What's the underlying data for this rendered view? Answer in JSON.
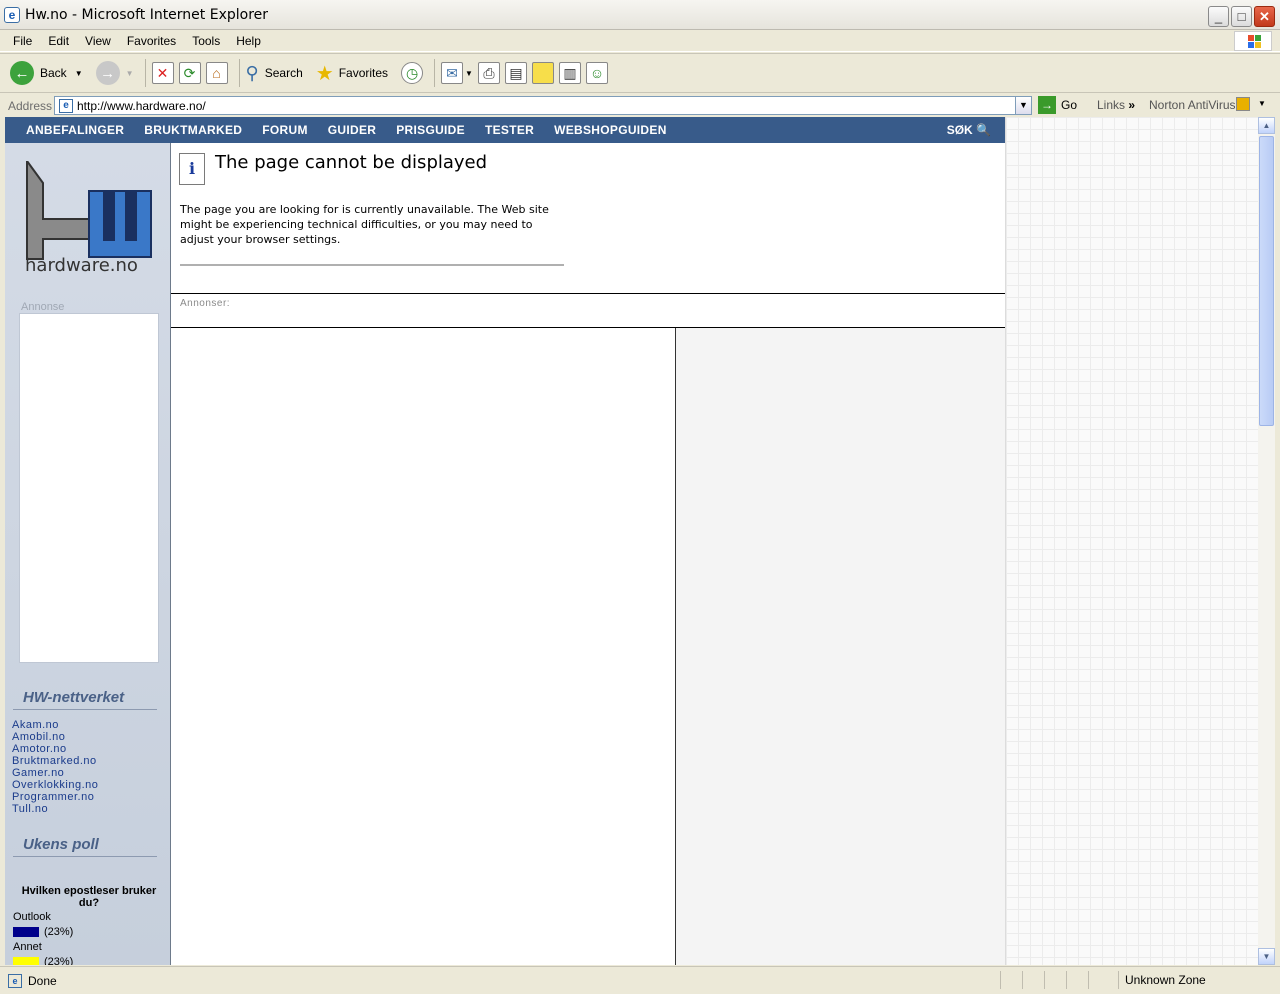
{
  "window": {
    "title": "Hw.no - Microsoft Internet Explorer"
  },
  "menu": [
    "File",
    "Edit",
    "View",
    "Favorites",
    "Tools",
    "Help"
  ],
  "toolbar": {
    "back_label": "Back",
    "search_label": "Search",
    "favorites_label": "Favorites"
  },
  "address": {
    "label": "Address",
    "url": "http://www.hardware.no/",
    "go_label": "Go",
    "links_label": "Links",
    "norton_label": "Norton AntiVirus"
  },
  "site": {
    "nav": [
      "ANBEFALINGER",
      "BRUKTMARKED",
      "FORUM",
      "GUIDER",
      "PRISGUIDE",
      "TESTER",
      "WEBSHOPGUIDEN"
    ],
    "search_label": "SØK",
    "logo_text": "hardware.no",
    "ad_label": "Annonse",
    "network_title": "HW-nettverket",
    "network_links": [
      "Akam.no",
      "Amobil.no",
      "Amotor.no",
      "Bruktmarked.no",
      "Gamer.no",
      "Overklokking.no",
      "Programmer.no",
      "Tull.no"
    ],
    "poll_title": "Ukens poll",
    "poll_question": "Hvilken epostleser bruker du?",
    "poll_options": [
      {
        "label": "Outlook",
        "pct": "(23%)",
        "color": "#00008b"
      },
      {
        "label": "Annet",
        "pct": "(23%)",
        "color": "#ffff00"
      }
    ]
  },
  "error": {
    "title": "The page cannot be displayed",
    "message": "The page you are looking for is currently unavailable. The Web site might be experiencing technical difficulties, or you may need to adjust your browser settings."
  },
  "annonser_label": "Annonser:",
  "status": {
    "text": "Done",
    "zone": "Unknown Zone"
  }
}
